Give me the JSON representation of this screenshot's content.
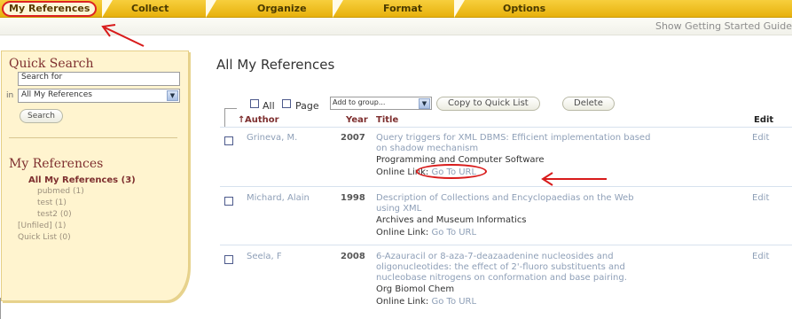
{
  "nav": {
    "tabs": [
      {
        "label": "My References"
      },
      {
        "label": "Collect"
      },
      {
        "label": "Organize"
      },
      {
        "label": "Format"
      },
      {
        "label": "Options"
      }
    ],
    "getting_started": "Show Getting Started Guide"
  },
  "sidebar": {
    "quick_search_title": "Quick Search",
    "search_value": "Search for",
    "in_label": "in",
    "scope_value": "All My References",
    "search_button": "Search",
    "my_refs_title": "My References",
    "tree": [
      {
        "label": "All My References (3)"
      },
      {
        "label": "pubmed (1)"
      },
      {
        "label": "test (1)"
      },
      {
        "label": "test2 (0)"
      },
      {
        "label": "[Unfiled] (1)"
      },
      {
        "label": "Quick List (0)"
      }
    ]
  },
  "main": {
    "title": "All My References",
    "toolbar": {
      "all_label": "All",
      "page_label": "Page",
      "group_select": "Add to group...",
      "copy_button": "Copy to Quick List",
      "delete_button": "Delete"
    },
    "columns": {
      "author": "Author",
      "year": "Year",
      "title": "Title",
      "edit": "Edit"
    },
    "sort_marker": "↑",
    "online_link_label": "Online Link",
    "online_link_value": "Go To URL",
    "rows": [
      {
        "author": "Grineva, M.",
        "year": "2007",
        "title_lines": [
          "Query triggers for XML DBMS: Efficient implementation based",
          "on shadow mechanism"
        ],
        "journal": "Programming and Computer Software",
        "edit": "Edit"
      },
      {
        "author": "Michard, Alain",
        "year": "1998",
        "title_lines": [
          "Description of Collections and Encyclopaedias on the Web",
          "using XML"
        ],
        "journal": "Archives and Museum Informatics",
        "edit": "Edit"
      },
      {
        "author": "Seela, F",
        "year": "2008",
        "title_lines": [
          "6-Azauracil or 8-aza-7-deazaadenine nucleosides and",
          "oligonucleotides: the effect of 2'-fluoro substituents and",
          "nucleobase nitrogens on conformation and base pairing."
        ],
        "journal": "Org Biomol Chem",
        "edit": "Edit"
      }
    ]
  },
  "colors": {
    "nav_gold": "#f0c020",
    "sidebar_bg": "#fff4cf",
    "heading_maroon": "#7e2f2f",
    "link_blue": "#8e9fb7",
    "annotation_red": "#d81b1b"
  }
}
